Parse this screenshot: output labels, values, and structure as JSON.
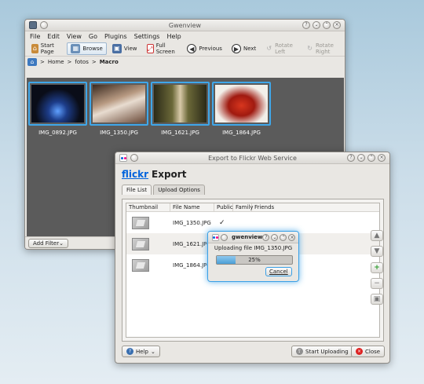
{
  "gwenview": {
    "title": "Gwenview",
    "menu": [
      "File",
      "Edit",
      "View",
      "Go",
      "Plugins",
      "Settings",
      "Help"
    ],
    "toolbar": {
      "start_page": "Start Page",
      "browse": "Browse",
      "view": "View",
      "full_screen": "Full Screen",
      "previous": "Previous",
      "next": "Next",
      "rotate_left": "Rotate Left",
      "rotate_right": "Rotate Right"
    },
    "breadcrumb": {
      "sep": ">",
      "home": "Home",
      "fotos": "fotos",
      "macro": "Macro"
    },
    "thumbnails": [
      "IMG_0892.JPG",
      "IMG_1350.JPG",
      "IMG_1621.JPG",
      "IMG_1864.JPG"
    ],
    "add_filter": "Add Filter"
  },
  "export": {
    "title": "Export to Flickr Web Service",
    "brand": "flickr",
    "heading": "Export",
    "tabs": [
      "File List",
      "Upload Options"
    ],
    "columns": [
      "Thumbnail",
      "File Name",
      "Public",
      "Family",
      "Friends"
    ],
    "rows": [
      {
        "file": "IMG_1350.JPG",
        "public_check": "✓"
      },
      {
        "file": "IMG_1621.JPG",
        "public_check": ""
      },
      {
        "file": "IMG_1864.JPG",
        "public_check": ""
      }
    ],
    "help": "Help",
    "start_uploading": "Start Uploading",
    "close": "Close"
  },
  "progress": {
    "title": "gwenview",
    "message": "Uploading file IMG_1350.JPG",
    "percent": 25,
    "percent_text": "25%",
    "cancel": "Cancel"
  },
  "colors": {
    "accent": "#3fa7ea",
    "flickr_blue": "#0063dc",
    "flickr_pink": "#ff0084"
  }
}
